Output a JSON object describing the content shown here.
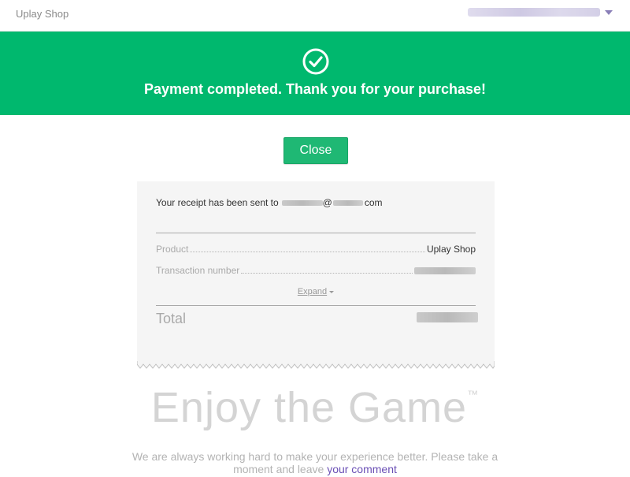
{
  "header": {
    "app_title": "Uplay Shop",
    "account_icon": "chevron-down-icon"
  },
  "banner": {
    "icon": "check-circle-icon",
    "message": "Payment completed. Thank you for your purchase!",
    "color": "#00b86e"
  },
  "actions": {
    "close_label": "Close"
  },
  "receipt": {
    "sent_prefix": "Your receipt has been sent to",
    "email_at": "@",
    "email_suffix": "com",
    "product_label": "Product",
    "product_value": "Uplay Shop",
    "transaction_label": "Transaction number",
    "expand_label": "Expand",
    "total_label": "Total"
  },
  "tagline": {
    "text": "Enjoy the Game",
    "trademark": "™"
  },
  "footer": {
    "text_before": "We are always working hard to make your experience better. Please take a moment and leave",
    "link_text": "your comment",
    "link_color": "#6a4fb5"
  }
}
